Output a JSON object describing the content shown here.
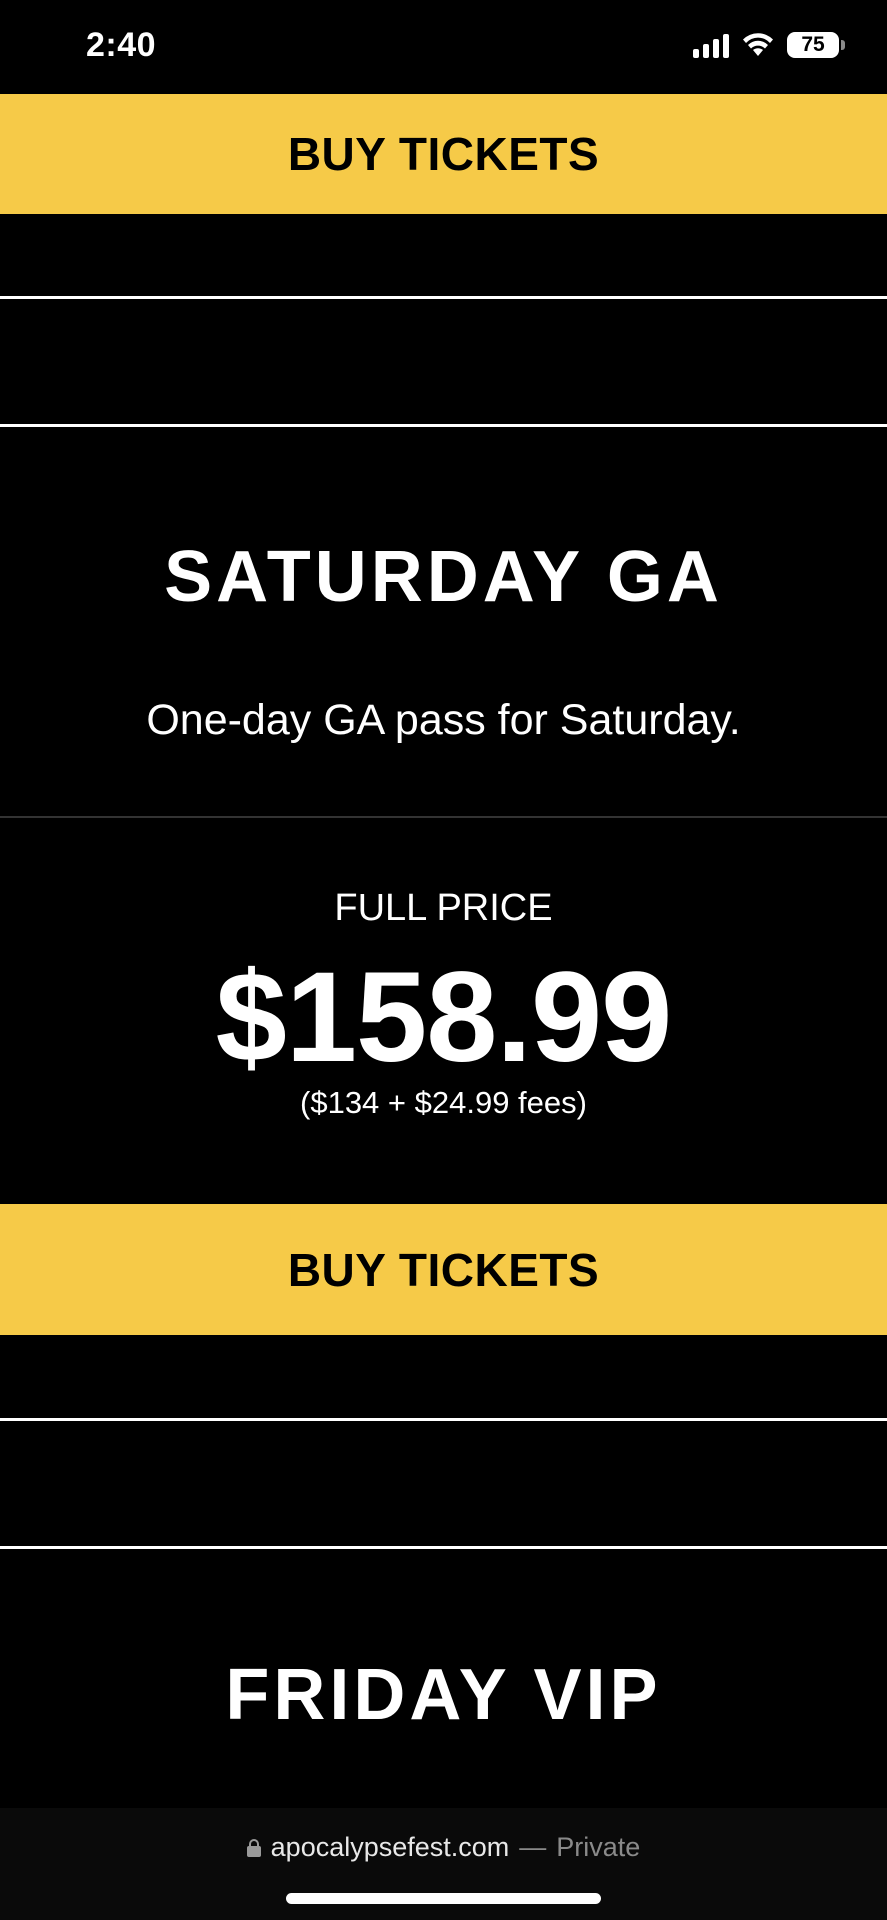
{
  "status_bar": {
    "time": "2:40",
    "battery": "75",
    "icons": [
      "signal-icon",
      "wifi-icon",
      "battery-icon"
    ]
  },
  "buy_buttons": {
    "top_label": "BUY TICKETS",
    "middle_label": "BUY TICKETS"
  },
  "ticket_saturday": {
    "title": "SATURDAY GA",
    "description": "One-day GA pass for Saturday.",
    "price_label": "FULL PRICE",
    "price": "$158.99",
    "price_breakdown": "($134 + $24.99 fees)"
  },
  "ticket_friday": {
    "title": "FRIDAY VIP"
  },
  "browser": {
    "domain": "apocalypsefest.com",
    "separator": "—",
    "mode": "Private"
  },
  "colors": {
    "background": "#000000",
    "accent_yellow": "#f6ca48",
    "text": "#ffffff"
  }
}
